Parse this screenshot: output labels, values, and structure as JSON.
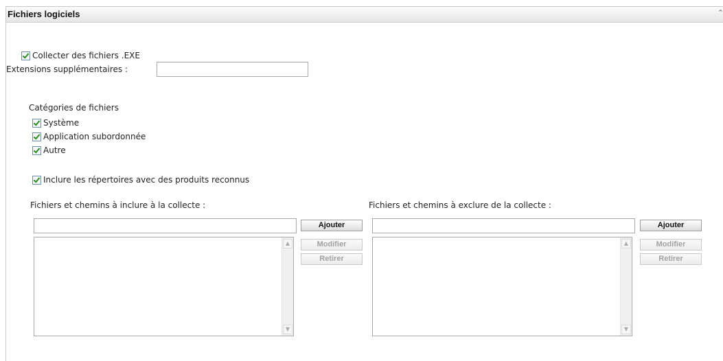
{
  "panel": {
    "title": "Fichiers logiciels",
    "collapse_glyph": "⌃"
  },
  "collect_exe": {
    "label": "Collecter des fichiers .EXE",
    "checked": true
  },
  "extensions": {
    "label": "Extensions supplémentaires :",
    "value": ""
  },
  "categories": {
    "heading": "Catégories de fichiers",
    "items": [
      {
        "label": "Système",
        "checked": true
      },
      {
        "label": "Application subordonnée",
        "checked": true
      },
      {
        "label": "Autre",
        "checked": true
      }
    ]
  },
  "include_dirs": {
    "label": "Inclure les répertoires avec des produits reconnus",
    "checked": true
  },
  "include_section": {
    "label": "Fichiers et chemins à inclure à la collecte :",
    "input_value": "",
    "add_label": "Ajouter",
    "modify_label": "Modifier",
    "remove_label": "Retirer"
  },
  "exclude_section": {
    "label": "Fichiers et chemins à exclure de la collecte :",
    "input_value": "",
    "add_label": "Ajouter",
    "modify_label": "Modifier",
    "remove_label": "Retirer"
  },
  "icons": {
    "scroll_up": "scroll-up-icon",
    "scroll_down": "scroll-down-icon",
    "check": "check-icon"
  }
}
